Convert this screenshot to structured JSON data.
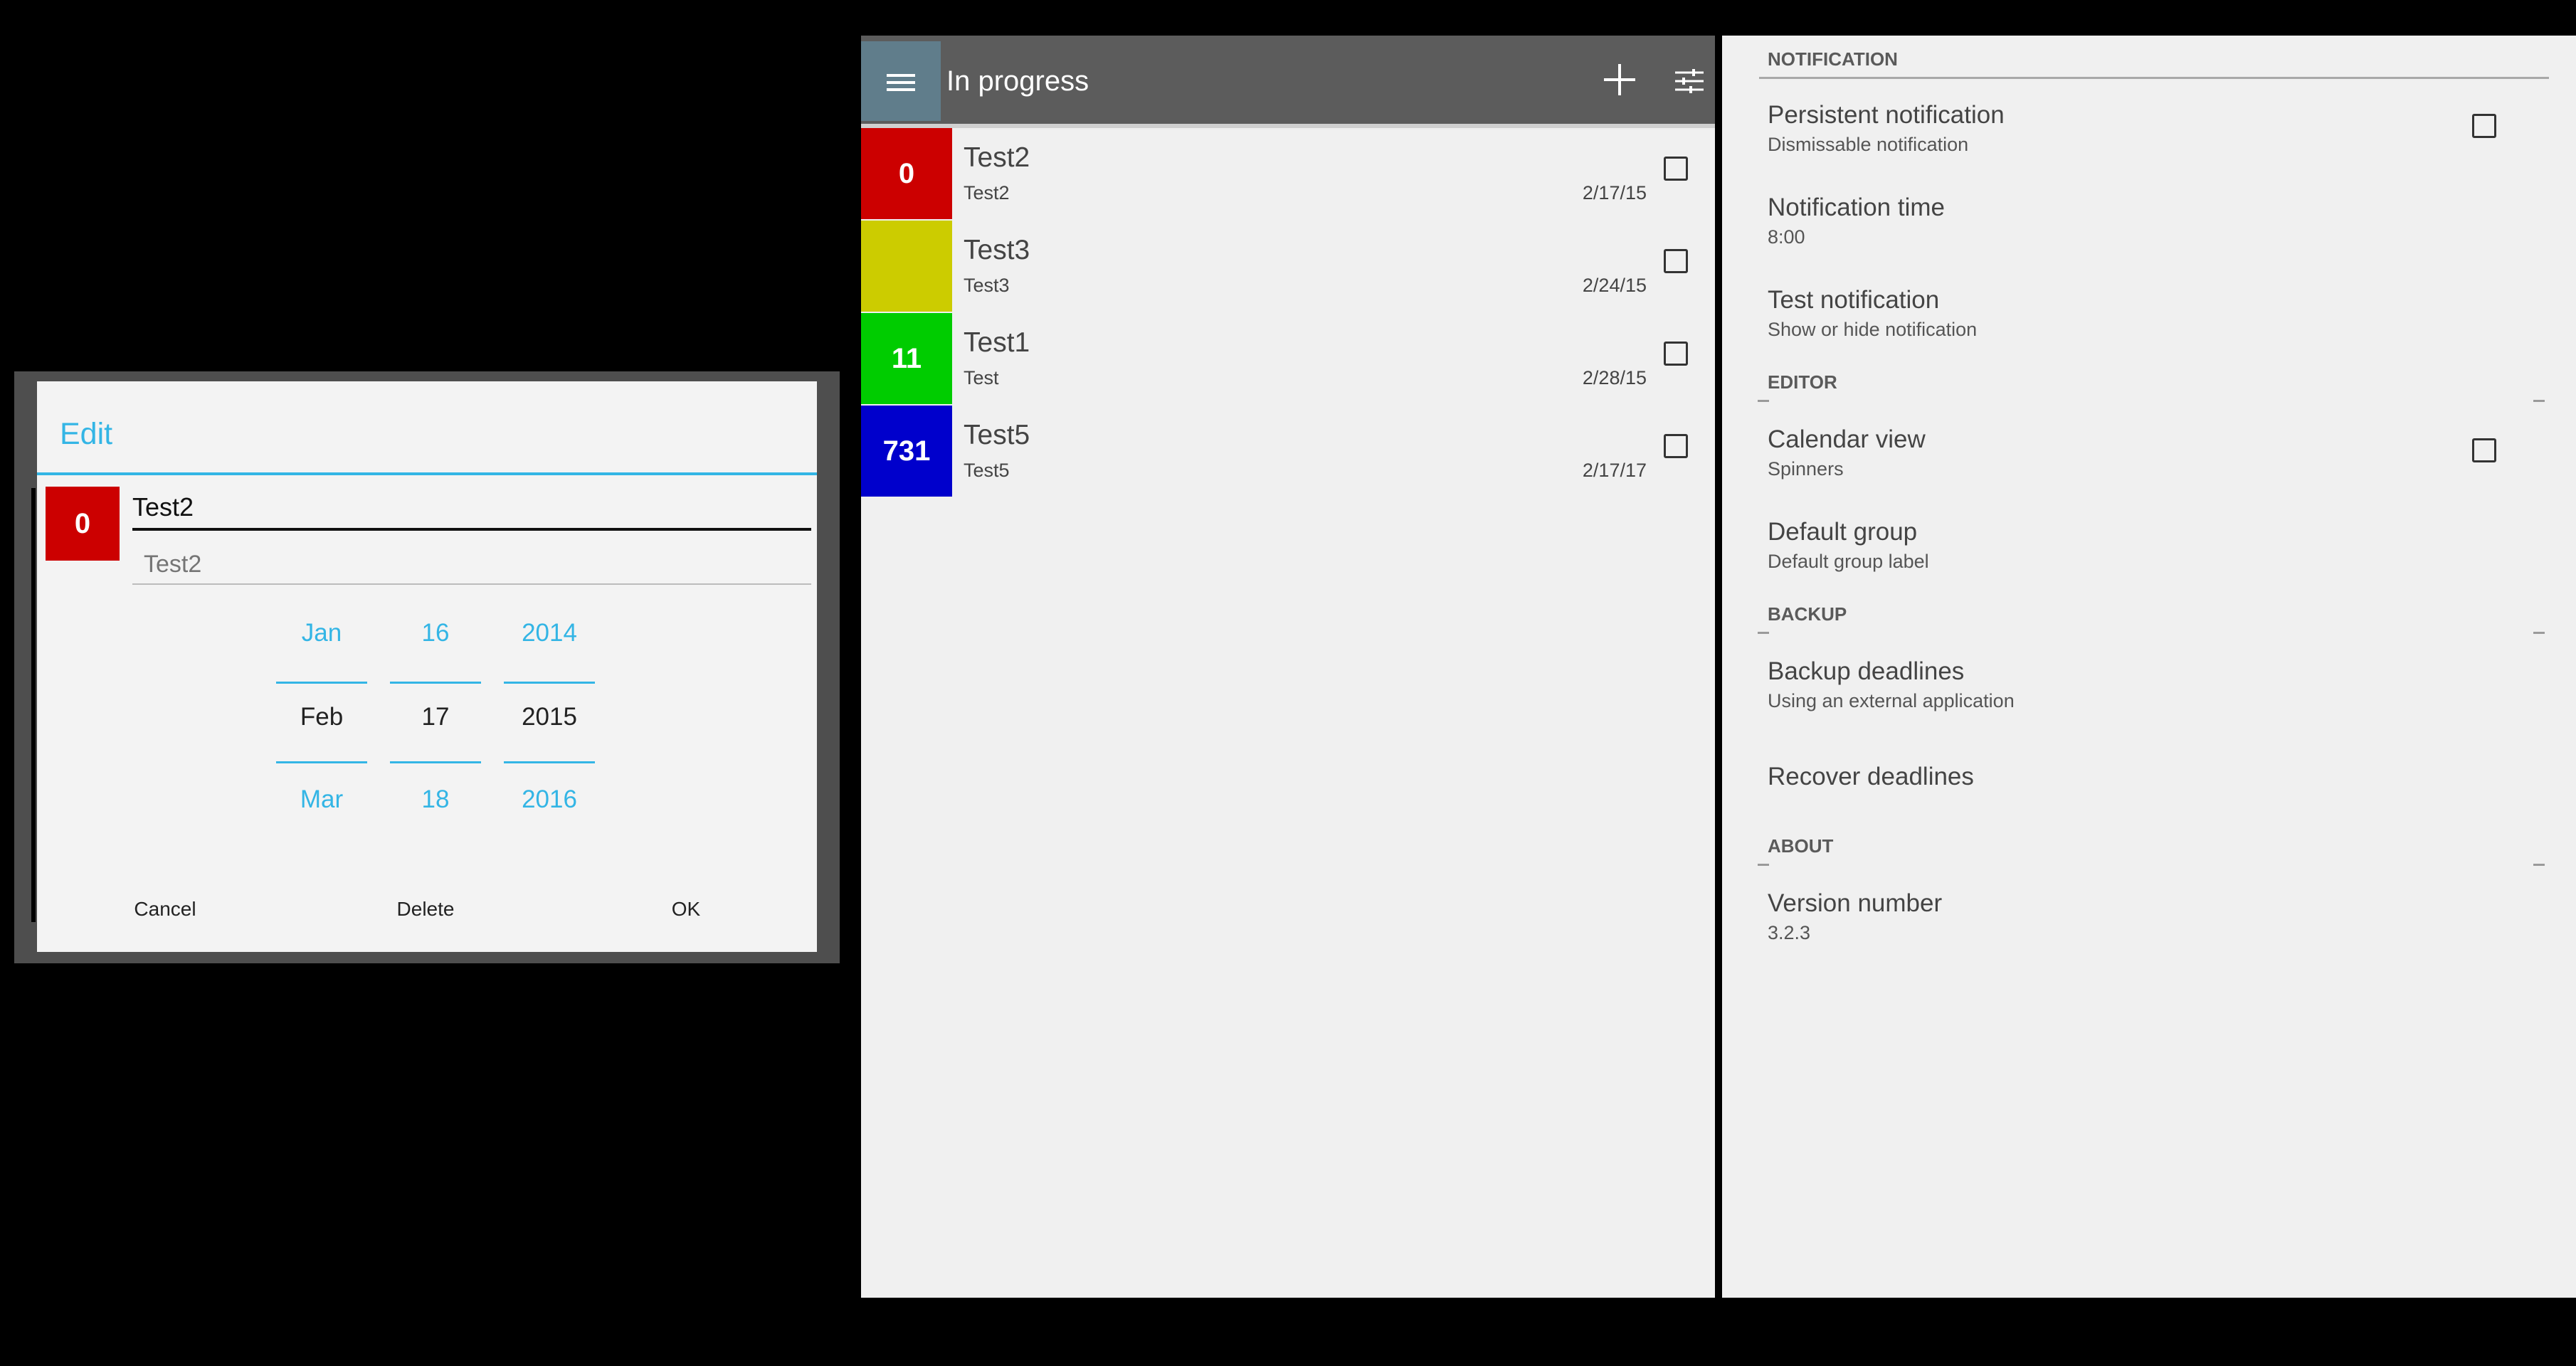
{
  "dialog": {
    "title": "Edit",
    "badge": "0",
    "name_value": "Test2",
    "description_placeholder": "Test2",
    "month": {
      "prev": "Jan",
      "current": "Feb",
      "next": "Mar"
    },
    "day": {
      "prev": "16",
      "current": "17",
      "next": "18"
    },
    "year": {
      "prev": "2014",
      "current": "2015",
      "next": "2016"
    },
    "buttons": {
      "cancel": "Cancel",
      "delete": "Delete",
      "ok": "OK"
    }
  },
  "list": {
    "title": "In progress",
    "items": [
      {
        "badge": "0",
        "color": "#cc0000",
        "title": "Test2",
        "subtitle": "Test2",
        "date": "2/17/15"
      },
      {
        "badge": "",
        "color": "#cccc00",
        "title": "Test3",
        "subtitle": "Test3",
        "date": "2/24/15"
      },
      {
        "badge": "11",
        "color": "#00cc00",
        "title": "Test1",
        "subtitle": "Test",
        "date": "2/28/15"
      },
      {
        "badge": "731",
        "color": "#0000cc",
        "title": "Test5",
        "subtitle": "Test5",
        "date": "2/17/17"
      }
    ]
  },
  "settings": {
    "sections": {
      "notification": "NOTIFICATION",
      "editor": "EDITOR",
      "backup": "BACKUP",
      "about": "ABOUT"
    },
    "persistent": {
      "title": "Persistent notification",
      "summary": "Dismissable notification"
    },
    "time": {
      "title": "Notification time",
      "summary": "8:00"
    },
    "test": {
      "title": "Test notification",
      "summary": "Show or hide notification"
    },
    "calendar": {
      "title": "Calendar view",
      "summary": "Spinners"
    },
    "group": {
      "title": "Default group",
      "summary": "Default group label"
    },
    "backup": {
      "title": "Backup deadlines",
      "summary": "Using an external application"
    },
    "recover": {
      "title": "Recover deadlines"
    },
    "version": {
      "title": "Version number",
      "summary": "3.2.3"
    }
  },
  "colors": {
    "accent": "#33b5e5",
    "appbar": "#5c5c5c",
    "menu_button": "#607d8b"
  }
}
